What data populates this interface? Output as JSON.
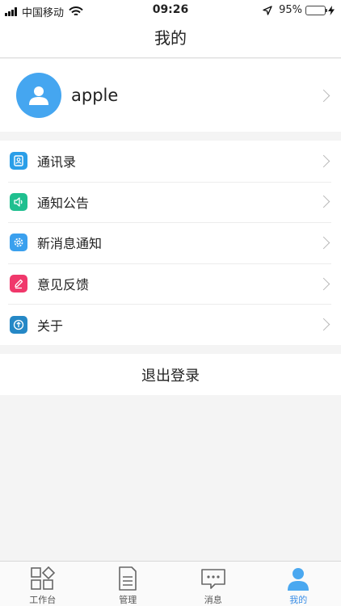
{
  "status": {
    "carrier": "中国移动",
    "time": "09:26",
    "battery": "95%",
    "battery_level": 0.95
  },
  "nav": {
    "title": "我的"
  },
  "profile": {
    "username": "apple"
  },
  "menu": {
    "items": [
      {
        "label": "通讯录",
        "icon": "contacts-icon",
        "color": "#2a9ee8"
      },
      {
        "label": "通知公告",
        "icon": "speaker-icon",
        "color": "#1fbf8f"
      },
      {
        "label": "新消息通知",
        "icon": "gear-icon",
        "color": "#3aa0ee"
      },
      {
        "label": "意见反馈",
        "icon": "pencil-icon",
        "color": "#f0386b"
      },
      {
        "label": "关于",
        "icon": "upload-icon",
        "color": "#2588c6"
      }
    ]
  },
  "logout": {
    "label": "退出登录"
  },
  "tabs": [
    {
      "label": "工作台",
      "icon": "workbench-icon"
    },
    {
      "label": "管理",
      "icon": "document-icon"
    },
    {
      "label": "消息",
      "icon": "message-icon"
    },
    {
      "label": "我的",
      "icon": "person-icon",
      "active": true
    }
  ],
  "colors": {
    "accent": "#3a8ee6",
    "avatar": "#45a6f0"
  }
}
